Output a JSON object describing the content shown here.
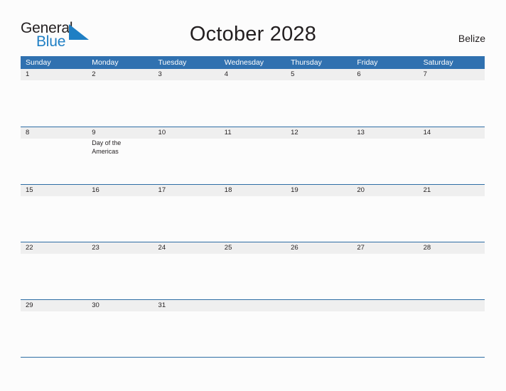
{
  "brand": {
    "name_part1": "General",
    "name_part2": "Blue",
    "flag_icon": "blue-triangle-flag-icon",
    "color_dark": "#231f20",
    "color_blue": "#1f7fc4"
  },
  "header": {
    "title": "October 2028",
    "country": "Belize"
  },
  "theme": {
    "header_blue": "#3071b0",
    "row_divider_blue": "#2e6da4",
    "date_band_gray": "#efefef",
    "page_background": "#fcfcfc",
    "text_color": "#231f20"
  },
  "calendar": {
    "month": "October",
    "year": "2028",
    "weekdays": [
      "Sunday",
      "Monday",
      "Tuesday",
      "Wednesday",
      "Thursday",
      "Friday",
      "Saturday"
    ],
    "weeks": [
      [
        {
          "date": "1",
          "event": ""
        },
        {
          "date": "2",
          "event": ""
        },
        {
          "date": "3",
          "event": ""
        },
        {
          "date": "4",
          "event": ""
        },
        {
          "date": "5",
          "event": ""
        },
        {
          "date": "6",
          "event": ""
        },
        {
          "date": "7",
          "event": ""
        }
      ],
      [
        {
          "date": "8",
          "event": ""
        },
        {
          "date": "9",
          "event": "Day of the Americas"
        },
        {
          "date": "10",
          "event": ""
        },
        {
          "date": "11",
          "event": ""
        },
        {
          "date": "12",
          "event": ""
        },
        {
          "date": "13",
          "event": ""
        },
        {
          "date": "14",
          "event": ""
        }
      ],
      [
        {
          "date": "15",
          "event": ""
        },
        {
          "date": "16",
          "event": ""
        },
        {
          "date": "17",
          "event": ""
        },
        {
          "date": "18",
          "event": ""
        },
        {
          "date": "19",
          "event": ""
        },
        {
          "date": "20",
          "event": ""
        },
        {
          "date": "21",
          "event": ""
        }
      ],
      [
        {
          "date": "22",
          "event": ""
        },
        {
          "date": "23",
          "event": ""
        },
        {
          "date": "24",
          "event": ""
        },
        {
          "date": "25",
          "event": ""
        },
        {
          "date": "26",
          "event": ""
        },
        {
          "date": "27",
          "event": ""
        },
        {
          "date": "28",
          "event": ""
        }
      ],
      [
        {
          "date": "29",
          "event": ""
        },
        {
          "date": "30",
          "event": ""
        },
        {
          "date": "31",
          "event": ""
        },
        {
          "date": "",
          "event": ""
        },
        {
          "date": "",
          "event": ""
        },
        {
          "date": "",
          "event": ""
        },
        {
          "date": "",
          "event": ""
        }
      ]
    ]
  }
}
